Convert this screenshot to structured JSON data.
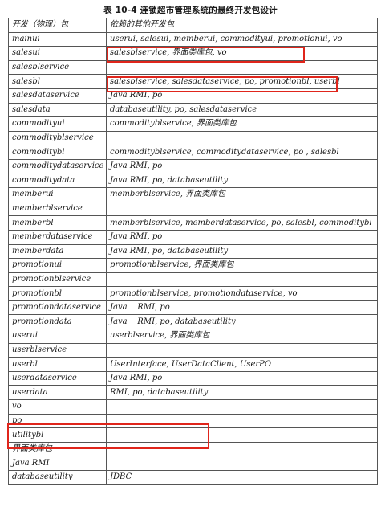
{
  "caption": "表 10-4   连锁超市管理系统的最终开发包设计",
  "table": {
    "headers": [
      "开发（物理）包",
      "依赖的其他开发包"
    ],
    "rows": [
      {
        "pkg": "mainui",
        "deps": "userui, salesui, memberui, commodityui, promotionui, vo"
      },
      {
        "pkg": "salesui",
        "deps": "salesblservice, 界面类库包, vo"
      },
      {
        "pkg": "salesblservice",
        "deps": ""
      },
      {
        "pkg": "salesbl",
        "deps": "salesblservice, salesdataservice, po, promotionbl, userbl"
      },
      {
        "pkg": "salesdataservice",
        "deps": "Java RMI, po"
      },
      {
        "pkg": "salesdata",
        "deps": "databaseutility, po, salesdataservice"
      },
      {
        "pkg": "commodityui",
        "deps": "commodityblservice, 界面类库包"
      },
      {
        "pkg": "commodityblservice",
        "deps": ""
      },
      {
        "pkg": "commoditybl",
        "deps": "commodityblservice, commoditydataservice, po , salesbl"
      },
      {
        "pkg": "commoditydataservice",
        "deps": "Java RMI, po"
      },
      {
        "pkg": "commoditydata",
        "deps": "Java RMI, po, databaseutility"
      },
      {
        "pkg": "memberui",
        "deps": "memberblservice, 界面类库包"
      },
      {
        "pkg": "memberblservice",
        "deps": ""
      },
      {
        "pkg": "memberbl",
        "deps": "memberblservice, memberdataservice, po, salesbl, commoditybl"
      },
      {
        "pkg": "memberdataservice",
        "deps": "Java RMI, po"
      },
      {
        "pkg": "memberdata",
        "deps": "Java RMI, po, databaseutility"
      },
      {
        "pkg": "promotionui",
        "deps": "promotionblservice, 界面类库包"
      },
      {
        "pkg": "promotionblservice",
        "deps": ""
      },
      {
        "pkg": "promotionbl",
        "deps": "promotionblservice, promotiondataservice, vo"
      },
      {
        "pkg": "promotiondataservice",
        "deps": "Java    RMI, po"
      },
      {
        "pkg": "promotiondata",
        "deps": "Java    RMI, po, databaseutility"
      },
      {
        "pkg": "userui",
        "deps": "userblservice, 界面类库包"
      },
      {
        "pkg": "userblservice",
        "deps": ""
      },
      {
        "pkg": "userbl",
        "deps": "UserInterface, UserDataClient, UserPO"
      },
      {
        "pkg": "userdataservice",
        "deps": "Java RMI, po"
      },
      {
        "pkg": "userdata",
        "deps": "RMI, po, databaseutility"
      },
      {
        "pkg": "vo",
        "deps": ""
      },
      {
        "pkg": "po",
        "deps": ""
      },
      {
        "pkg": "utilitybl",
        "deps": ""
      },
      {
        "pkg": "界面类库包",
        "deps": ""
      },
      {
        "pkg": "Java RMI",
        "deps": ""
      },
      {
        "pkg": "databaseutility",
        "deps": "JDBC"
      }
    ]
  },
  "highlight_color": "#e0251b"
}
